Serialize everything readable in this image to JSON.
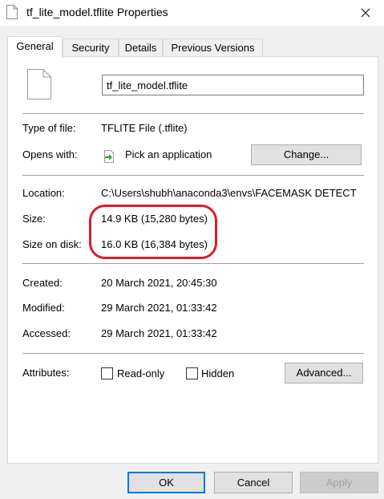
{
  "window": {
    "title": "tf_lite_model.tflite Properties",
    "close_icon": "close-icon"
  },
  "tabs": [
    {
      "label": "General",
      "active": true
    },
    {
      "label": "Security",
      "active": false
    },
    {
      "label": "Details",
      "active": false
    },
    {
      "label": "Previous Versions",
      "active": false
    }
  ],
  "file": {
    "name": "tf_lite_model.tflite",
    "icon": "file-icon"
  },
  "type_section": {
    "type_label": "Type of file:",
    "type_value": "TFLITE File (.tflite)",
    "opens_label": "Opens with:",
    "opens_value": "Pick an application",
    "opens_icon": "green-arrow-icon",
    "change_button": "Change..."
  },
  "location_section": {
    "location_label": "Location:",
    "location_value": "C:\\Users\\shubh\\anaconda3\\envs\\FACEMASK DETECT",
    "size_label": "Size:",
    "size_value": "14.9 KB (15,280 bytes)",
    "size_on_disk_label": "Size on disk:",
    "size_on_disk_value": "16.0 KB (16,384 bytes)"
  },
  "dates_section": {
    "created_label": "Created:",
    "created_value": "20 March 2021, 20:45:30",
    "modified_label": "Modified:",
    "modified_value": "29 March 2021, 01:33:42",
    "accessed_label": "Accessed:",
    "accessed_value": "29 March 2021, 01:33:42"
  },
  "attributes": {
    "label": "Attributes:",
    "readonly_label": "Read-only",
    "readonly_checked": false,
    "hidden_label": "Hidden",
    "hidden_checked": false,
    "advanced_button": "Advanced..."
  },
  "footer": {
    "ok": "OK",
    "cancel": "Cancel",
    "apply": "Apply"
  },
  "colors": {
    "annotation_circle": "#e01b24",
    "focus_border": "#0078d7"
  }
}
